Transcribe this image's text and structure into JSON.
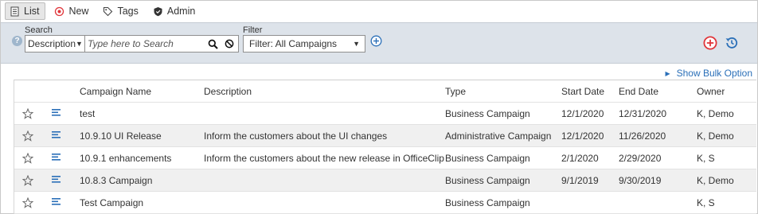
{
  "toolbar": {
    "items": [
      {
        "label": "List",
        "icon": "list-doc-icon",
        "active": true
      },
      {
        "label": "New",
        "icon": "new-circle-icon"
      },
      {
        "label": "Tags",
        "icon": "tag-icon"
      },
      {
        "label": "Admin",
        "icon": "shield-icon"
      }
    ]
  },
  "search": {
    "label": "Search",
    "field_selected": "Description",
    "placeholder": "Type here to Search"
  },
  "filter": {
    "label": "Filter",
    "selected": "Filter: All Campaigns"
  },
  "bulk_option": "Show Bulk Option",
  "colors": {
    "accent_blue": "#2a6fb8",
    "add_red": "#e0353a",
    "band_bg": "#dde3ea"
  },
  "grid": {
    "columns": [
      "Campaign Name",
      "Description",
      "Type",
      "Start Date",
      "End Date",
      "Owner"
    ],
    "rows": [
      {
        "name": "test",
        "description": "",
        "type": "Business Campaign",
        "start": "12/1/2020",
        "end": "12/31/2020",
        "owner": "K, Demo"
      },
      {
        "name": "10.9.10 UI Release",
        "description": "Inform the customers about the UI changes",
        "type": "Administrative Campaign",
        "start": "12/1/2020",
        "end": "11/26/2020",
        "owner": "K, Demo"
      },
      {
        "name": "10.9.1 enhancements",
        "description": "Inform the customers about the new release in OfficeClip",
        "type": "Business Campaign",
        "start": "2/1/2020",
        "end": "2/29/2020",
        "owner": "K, S"
      },
      {
        "name": "10.8.3 Campaign",
        "description": "",
        "type": "Business Campaign",
        "start": "9/1/2019",
        "end": "9/30/2019",
        "owner": "K, Demo"
      },
      {
        "name": "Test Campaign",
        "description": "",
        "type": "Business Campaign",
        "start": "",
        "end": "",
        "owner": "K, S"
      }
    ]
  }
}
